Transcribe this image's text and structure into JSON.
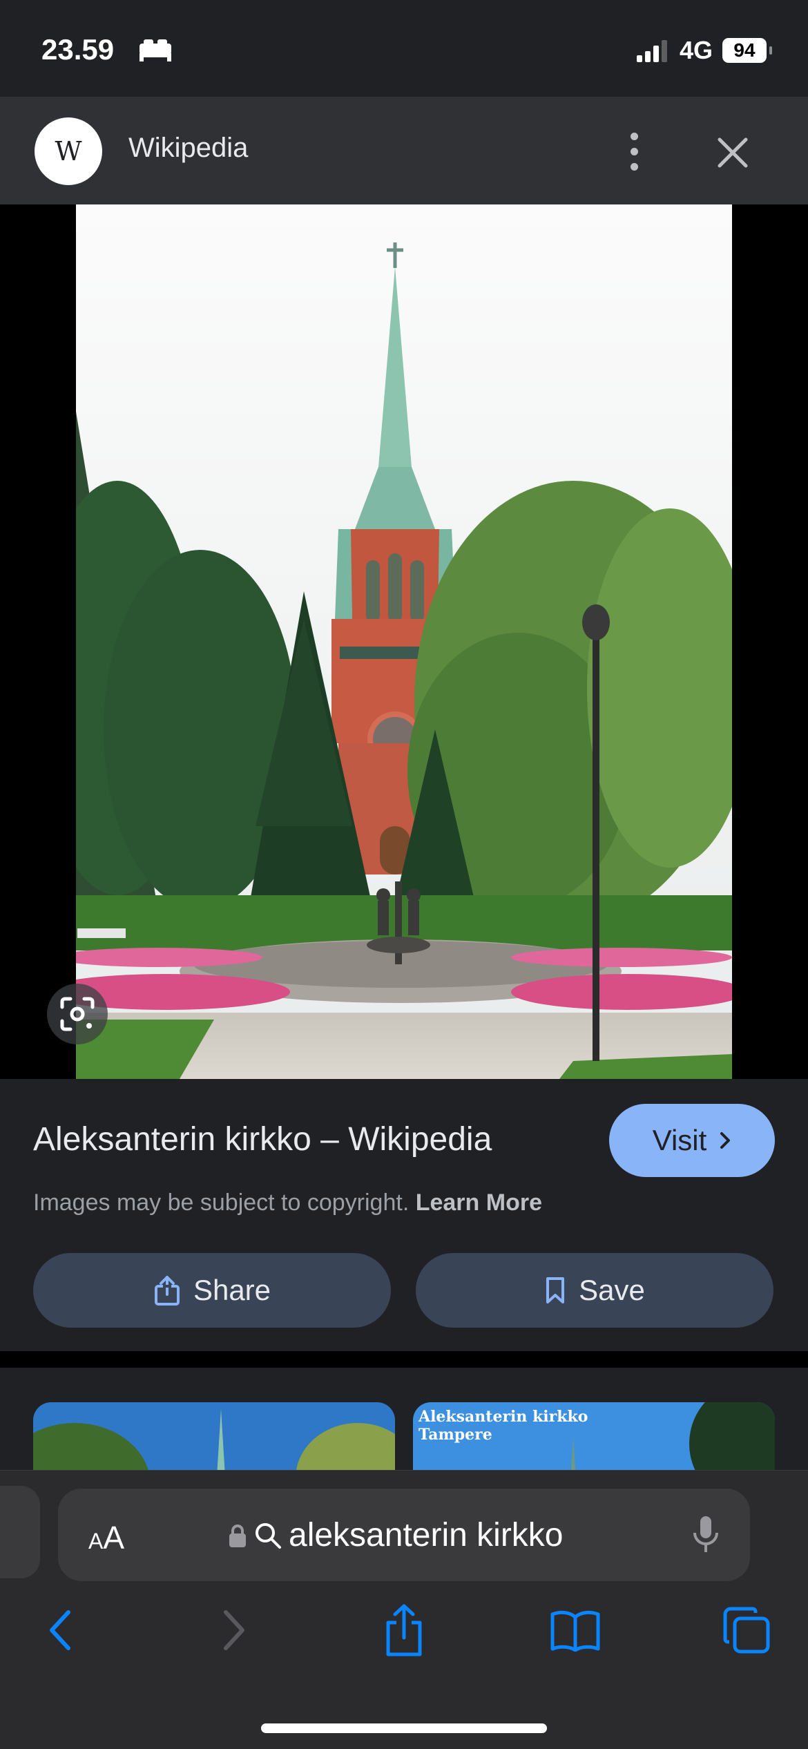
{
  "status_bar": {
    "time": "23.59",
    "sleep_icon": "bed-icon",
    "signal_icon": "cellular-signal-icon",
    "network": "4G",
    "battery": "94"
  },
  "viewer_header": {
    "site_logo": "W",
    "site_name": "Wikipedia",
    "more_icon": "vertical-dots-icon",
    "close_icon": "close-icon"
  },
  "image": {
    "lens_icon": "google-lens-icon"
  },
  "result": {
    "title": "Aleksanterin kirkko – Wikipedia",
    "visit_label": "Visit",
    "copyright_text": "Images may be subject to copyright.",
    "learn_more": "Learn More",
    "share_label": "Share",
    "save_label": "Save"
  },
  "related": {
    "thumb2_caption_line1": "Aleksanterin kirkko",
    "thumb2_caption_line2": "Tampere"
  },
  "browser": {
    "text_size_label": "AA",
    "query": "aleksanterin kirkko",
    "lock_icon": "lock-icon",
    "search_icon": "search-icon",
    "mic_icon": "microphone-icon",
    "nav": [
      "back-icon",
      "forward-icon",
      "share-icon",
      "bookmarks-icon",
      "tabs-icon"
    ]
  },
  "colors": {
    "accent": "#8ab4f8",
    "pill_bg": "#394457",
    "ios_blue": "#0a84ff"
  }
}
